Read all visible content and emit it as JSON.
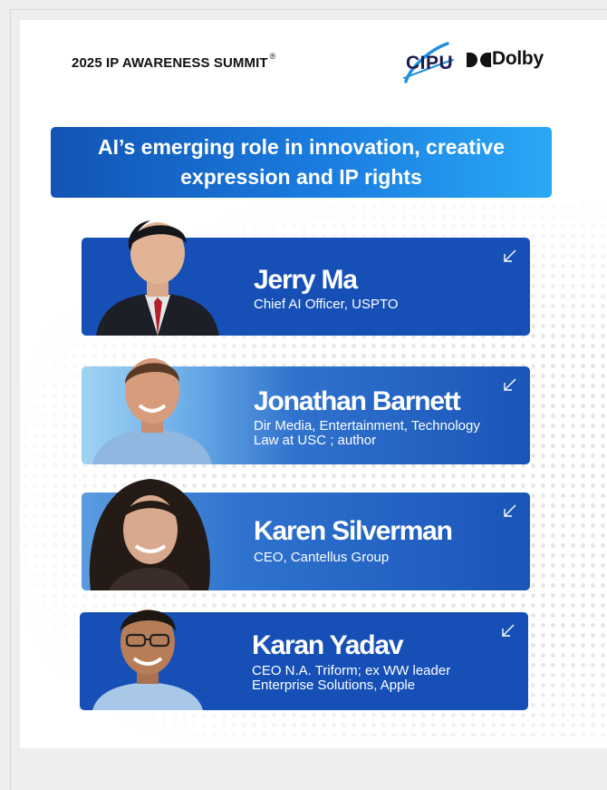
{
  "header": {
    "summit_title": "2025 IP AWARENESS SUMMIT",
    "registered_mark": "®",
    "cipu_logo_text": "CIPU",
    "dolby_logo_text": "Dolby"
  },
  "banner": {
    "line1": "AI’s emerging role in innovation, creative",
    "line2": "expression and IP rights"
  },
  "speakers": [
    {
      "name": "Jerry Ma",
      "role_line1": "Chief AI Officer, USPTO",
      "role_line2": ""
    },
    {
      "name": "Jonathan Barnett",
      "role_line1": "Dir Media, Entertainment, Technology",
      "role_line2": "Law at USC ; author"
    },
    {
      "name": "Karen Silverman",
      "role_line1": "CEO, Cantellus Group",
      "role_line2": ""
    },
    {
      "name": "Karan Yadav",
      "role_line1": "CEO N.A. Triform; ex WW leader",
      "role_line2": "Enterprise Solutions, Apple"
    }
  ],
  "colors": {
    "card_blue": "#1650b7",
    "banner_start": "#1254b4",
    "banner_end": "#2aa8f5",
    "cipu_navy": "#1b1d4a",
    "cipu_swoosh": "#1d8fe0"
  },
  "icons": {
    "expand": "arrow-down-left-icon"
  }
}
